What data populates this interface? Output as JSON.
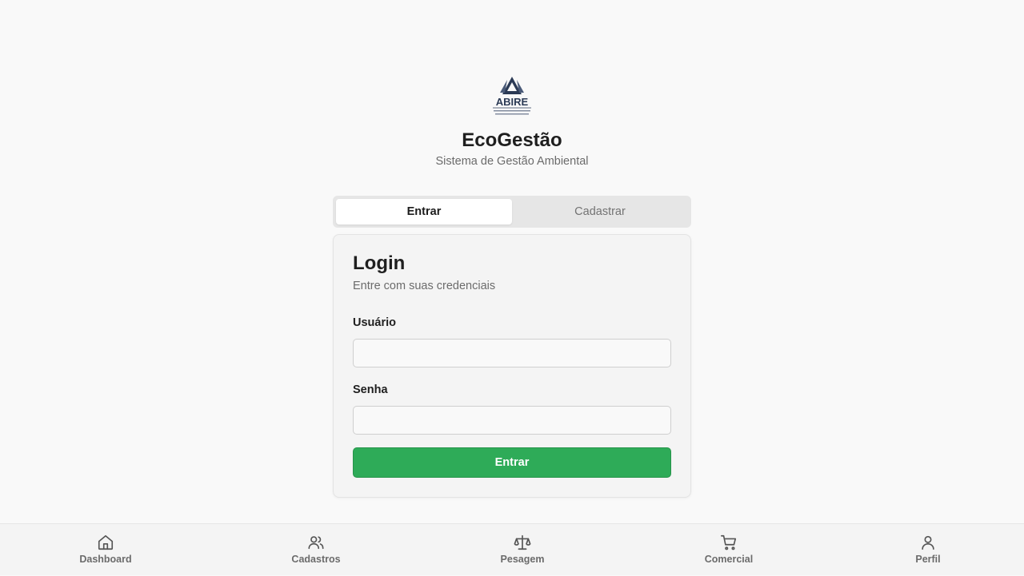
{
  "logo": {
    "icon": "abire-logo-icon",
    "text": "ABIRE",
    "tagline": "ASSOCIAÇÃO BRASILEIRA DAS INDÚSTRIAS DE RECICLAGEM"
  },
  "header": {
    "title": "EcoGestão",
    "subtitle": "Sistema de Gestão Ambiental"
  },
  "tabs": [
    {
      "label": "Entrar",
      "active": true
    },
    {
      "label": "Cadastrar",
      "active": false
    }
  ],
  "login": {
    "title": "Login",
    "description": "Entre com suas credenciais",
    "username_label": "Usuário",
    "username_value": "",
    "password_label": "Senha",
    "password_value": "",
    "submit_label": "Entrar"
  },
  "bottom_nav": [
    {
      "label": "Dashboard",
      "icon": "home-icon"
    },
    {
      "label": "Cadastros",
      "icon": "users-icon"
    },
    {
      "label": "Pesagem",
      "icon": "scale-icon"
    },
    {
      "label": "Comercial",
      "icon": "cart-icon"
    },
    {
      "label": "Perfil",
      "icon": "user-icon"
    }
  ],
  "colors": {
    "primary": "#2eab58",
    "background": "#f9f9f9",
    "logo_navy": "#2b3a55"
  }
}
